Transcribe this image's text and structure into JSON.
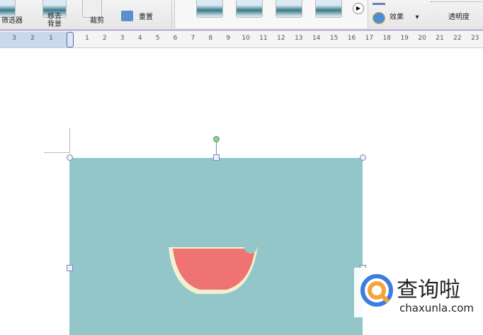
{
  "ribbon": {
    "filter_label": "筛选器",
    "remove_bg_label": "移去\n背景",
    "crop_label": "裁剪",
    "replace_label": "重置",
    "effects_label": "效果",
    "transparency_label": "透明度",
    "more_styles_icon": "play-circle-icon"
  },
  "ruler": {
    "left": [
      "3",
      "2",
      "1"
    ],
    "right": [
      "1",
      "2",
      "3",
      "4",
      "5",
      "6",
      "7",
      "8",
      "9",
      "10",
      "11",
      "12",
      "13",
      "14",
      "15",
      "16",
      "17",
      "18",
      "19",
      "20",
      "21",
      "22",
      "23"
    ]
  },
  "watermark": {
    "brand": "查询啦",
    "url": "chaxunla.com"
  },
  "colors": {
    "picture": "#93c6c8",
    "watermelon": "#f07373",
    "brand_blue": "#3b7de0",
    "brand_orange": "#f4a53a"
  }
}
